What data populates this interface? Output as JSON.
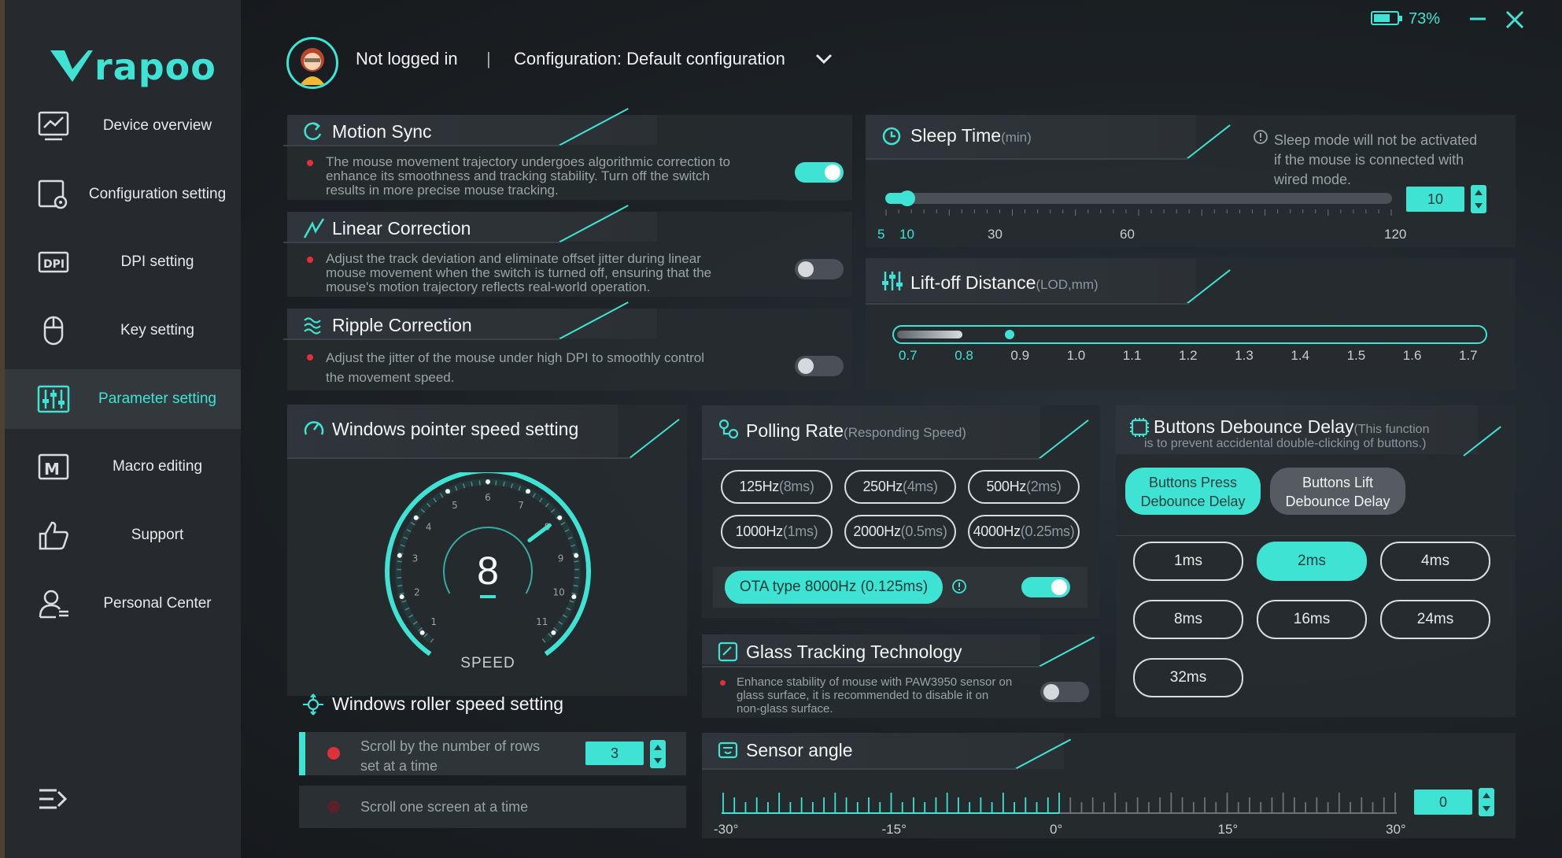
{
  "window": {
    "battery_percent": "73%",
    "battery_level": 0.73
  },
  "sidebar": {
    "brand": "rapoo",
    "items": [
      {
        "label": "Device overview",
        "icon": "monitor-chart-icon"
      },
      {
        "label": "Configuration setting",
        "icon": "config-gear-icon"
      },
      {
        "label": "DPI setting",
        "icon": "dpi-icon"
      },
      {
        "label": "Key setting",
        "icon": "mouse-icon"
      },
      {
        "label": "Parameter setting",
        "icon": "sliders-icon",
        "active": true
      },
      {
        "label": "Macro editing",
        "icon": "macro-icon"
      },
      {
        "label": "Support",
        "icon": "thumbs-up-icon"
      },
      {
        "label": "Personal Center",
        "icon": "user-icon"
      }
    ]
  },
  "header": {
    "login_status": "Not logged in",
    "separator": "|",
    "configuration": "Configuration: Default configuration"
  },
  "motion_sync": {
    "title": "Motion Sync",
    "desc": [
      "The mouse movement trajectory undergoes algorithmic correction to",
      "enhance its smoothness and tracking stability. Turn off the switch",
      "results in more precise mouse tracking."
    ],
    "enabled": true
  },
  "linear_correction": {
    "title": "Linear Correction",
    "desc": [
      "Adjust the track deviation and eliminate offset jitter during linear",
      "mouse movement when the switch is turned off, ensuring that the",
      "mouse's motion trajectory reflects real-world operation."
    ],
    "enabled": false
  },
  "ripple_correction": {
    "title": "Ripple Correction",
    "desc": [
      "Adjust the jitter of the mouse under high DPI to smoothly control",
      "the movement speed."
    ],
    "enabled": false
  },
  "sleep_time": {
    "title": "Sleep Time",
    "unit": "(min)",
    "note": [
      "Sleep mode will not be activated",
      "if the mouse is connected with",
      "wired mode."
    ],
    "value": "10",
    "min": 5,
    "max": 120,
    "ticks": [
      "5",
      "10",
      "30",
      "60",
      "120"
    ]
  },
  "lod": {
    "title": "Lift-off Distance",
    "unit": "(LOD,mm)",
    "value": 0.8,
    "ticks": [
      "0.7",
      "0.8",
      "0.9",
      "1.0",
      "1.1",
      "1.2",
      "1.3",
      "1.4",
      "1.5",
      "1.6",
      "1.7"
    ]
  },
  "pointer_speed": {
    "title": "Windows pointer speed setting",
    "value": "8",
    "label": "SPEED",
    "dial_numbers": [
      "1",
      "2",
      "3",
      "4",
      "5",
      "6",
      "7",
      "8",
      "9",
      "10",
      "11"
    ]
  },
  "roller_speed": {
    "title": "Windows roller speed setting",
    "option_rows_line1": "Scroll by the number of rows",
    "option_rows_line2": "set at a time",
    "rows_value": "3",
    "option_screen": "Scroll one screen at a time"
  },
  "polling_rate": {
    "title": "Polling Rate",
    "subtitle": "(Responding Speed)",
    "options": [
      {
        "rate": "125Hz",
        "ms": "(8ms)"
      },
      {
        "rate": "250Hz",
        "ms": "(4ms)"
      },
      {
        "rate": "500Hz",
        "ms": "(2ms)"
      },
      {
        "rate": "1000Hz",
        "ms": "(1ms)"
      },
      {
        "rate": "2000Hz",
        "ms": "(0.5ms)"
      },
      {
        "rate": "4000Hz",
        "ms": "(0.25ms)"
      }
    ],
    "ota_label": "OTA type 8000Hz (0.125ms)",
    "ota_enabled": true
  },
  "glass_tracking": {
    "title": "Glass Tracking Technology",
    "desc": [
      "Enhance stability of mouse with PAW3950 sensor on",
      "glass surface, it is recommended to disable it on",
      "non-glass surface."
    ],
    "enabled": false
  },
  "debounce": {
    "title": "Buttons Debounce Delay",
    "note_line1": "(This function",
    "note_line2": "is to prevent accidental double-clicking of buttons.)",
    "tab_press": [
      "Buttons Press",
      "Debounce Delay"
    ],
    "tab_lift": [
      "Buttons Lift",
      "Debounce Delay"
    ],
    "options": [
      "1ms",
      "2ms",
      "4ms",
      "8ms",
      "16ms",
      "24ms",
      "32ms"
    ],
    "selected": "2ms"
  },
  "sensor_angle": {
    "title": "Sensor angle",
    "value": "0",
    "min": -30,
    "max": 30,
    "ticks": [
      "-30°",
      "-15°",
      "0°",
      "15°",
      "30°"
    ]
  }
}
